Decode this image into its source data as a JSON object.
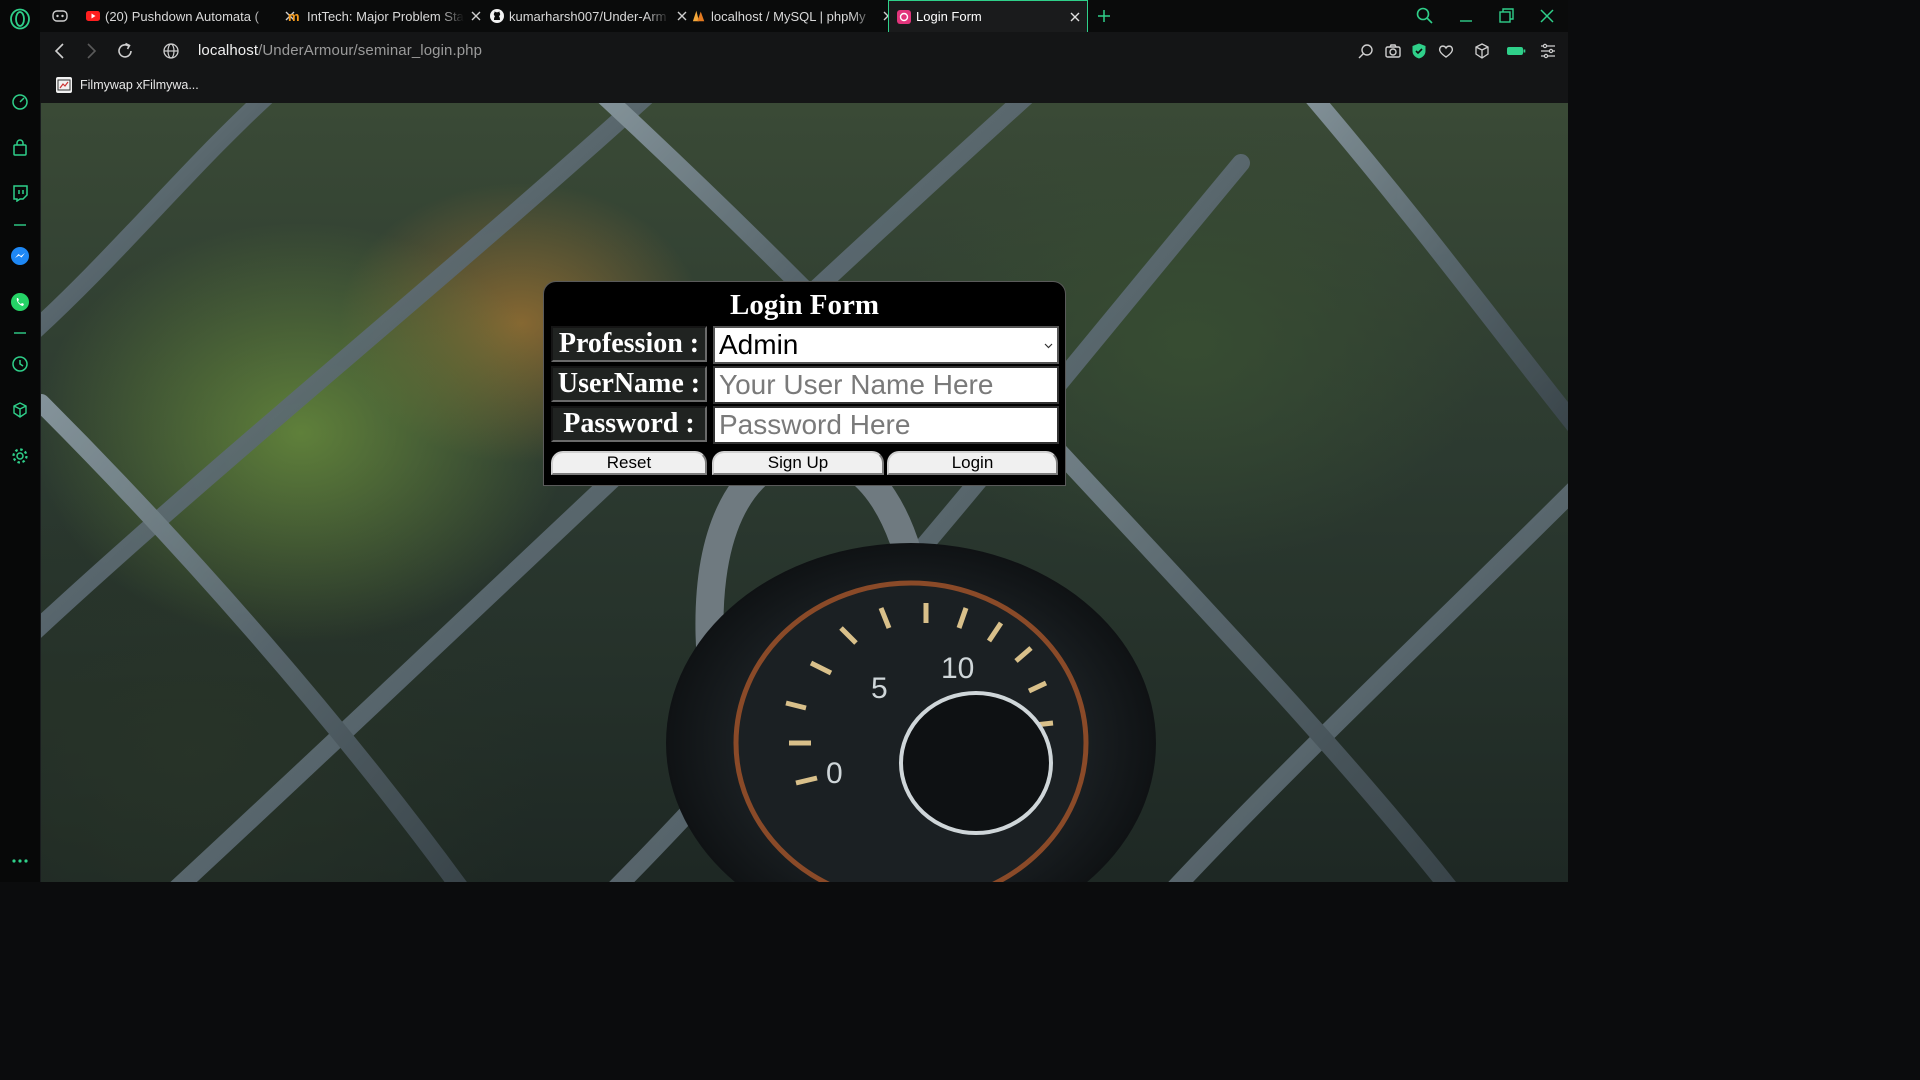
{
  "tabs": [
    {
      "title": "(20) Pushdown Automata (",
      "favicon": "youtube-icon",
      "active": false
    },
    {
      "title": "IntTech: Major Problem Stat",
      "favicon": "intt-icon",
      "active": false
    },
    {
      "title": "kumarharsh007/Under-Arm",
      "favicon": "github-icon",
      "active": false
    },
    {
      "title": "localhost / MySQL | phpMy",
      "favicon": "phpmyadmin-icon",
      "active": false
    },
    {
      "title": "Login Form",
      "favicon": "login-form-icon",
      "active": true
    }
  ],
  "address": {
    "host": "localhost",
    "path": "/UnderArmour/seminar_login.php"
  },
  "bookmarks": [
    {
      "label": "Filmywap xFilmywa..."
    }
  ],
  "sidebar_icons": [
    "speed-dial-icon",
    "shopping-bag-icon",
    "twitch-icon",
    "messenger-icon",
    "whatsapp-icon",
    "history-icon",
    "extensions-icon",
    "settings-icon",
    "more-icon"
  ],
  "accent_color": "#2fd08a",
  "login": {
    "title": "Login Form",
    "profession_label": "Profession :",
    "profession_value": "Admin",
    "username_label": "UserName :",
    "username_placeholder": "Your User Name Here",
    "password_label": "Password :",
    "password_placeholder": "Password Here",
    "reset_label": "Reset",
    "signup_label": "Sign Up",
    "login_label": "Login"
  }
}
